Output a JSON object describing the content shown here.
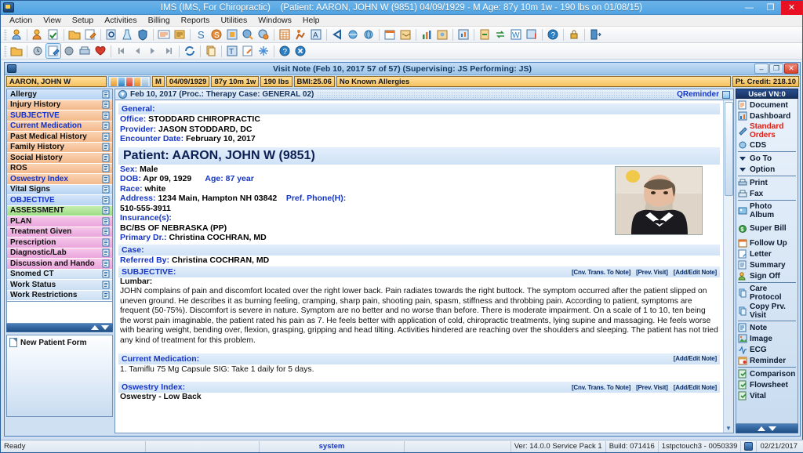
{
  "window": {
    "title": "IMS (IMS, For Chiropractic)",
    "patient_title": "(Patient: AARON, JOHN W (9851) 04/09/1929 - M Age: 87y 10m 1w - 190 lbs on 01/08/15)",
    "minimize": "—",
    "maximize": "❐",
    "close": "✕"
  },
  "menu": {
    "items": [
      "Action",
      "View",
      "Setup",
      "Activities",
      "Billing",
      "Reports",
      "Utilities",
      "Windows",
      "Help"
    ]
  },
  "visit_window": {
    "title": "Visit Note (Feb 10, 2017   57 of 57) (Supervising: JS Performing: JS)",
    "minimize": "–",
    "restore": "❐",
    "close": "✕"
  },
  "patient_bar": {
    "name": "AARON, JOHN W",
    "sex": "M",
    "dob": "04/09/1929",
    "age": "87y 10m 1w",
    "weight": "190 lbs",
    "bmi": "BMI:25.06",
    "allergies": "No Known Allergies",
    "credit": "Pt. Credit: 218.10"
  },
  "sidebar": {
    "items": [
      {
        "label": "Allergy",
        "color": "nav-blue",
        "text": ""
      },
      {
        "label": "Injury History",
        "color": "nav-orange",
        "text": ""
      },
      {
        "label": "SUBJECTIVE",
        "color": "nav-orange",
        "text": "txt-blue"
      },
      {
        "label": "Current Medication",
        "color": "nav-orange",
        "text": "txt-blue"
      },
      {
        "label": "Past Medical History",
        "color": "nav-orange",
        "text": ""
      },
      {
        "label": "Family History",
        "color": "nav-orange",
        "text": ""
      },
      {
        "label": "Social History",
        "color": "nav-orange",
        "text": ""
      },
      {
        "label": "ROS",
        "color": "nav-orange",
        "text": ""
      },
      {
        "label": "Oswestry Index",
        "color": "nav-orange",
        "text": "txt-blue"
      },
      {
        "label": "Vital Signs",
        "color": "nav-blue",
        "text": ""
      },
      {
        "label": "OBJECTIVE",
        "color": "nav-blue",
        "text": "txt-blue"
      },
      {
        "label": "ASSESSMENT",
        "color": "nav-green",
        "text": ""
      },
      {
        "label": "PLAN",
        "color": "nav-pink",
        "text": ""
      },
      {
        "label": "Treatment Given",
        "color": "nav-pink",
        "text": ""
      },
      {
        "label": "Prescription",
        "color": "nav-pink",
        "text": ""
      },
      {
        "label": "Diagnostic/Lab",
        "color": "nav-pink",
        "text": ""
      },
      {
        "label": "Discussion and Hando",
        "color": "nav-pink",
        "text": ""
      },
      {
        "label": "Snomed CT",
        "color": "nav-gray",
        "text": ""
      },
      {
        "label": "Work Status",
        "color": "nav-gray",
        "text": ""
      },
      {
        "label": "Work Restrictions",
        "color": "nav-gray",
        "text": ""
      }
    ],
    "new_patient_form": "New Patient Form"
  },
  "visit_header": {
    "date_line": "Feb 10, 2017  (Proc.: Therapy   Case: GENERAL 02)",
    "qreminder": "QReminder"
  },
  "note": {
    "general_heading": "General:",
    "office_key": "Office: ",
    "office_val": "STODDARD CHIROPRACTIC",
    "provider_key": "Provider: ",
    "provider_val": "JASON STODDARD, DC",
    "encounter_key": "Encounter Date: ",
    "encounter_val": "February 10, 2017",
    "patient_heading": "Patient: AARON, JOHN W  (9851)",
    "sex_key": "Sex: ",
    "sex_val": "Male",
    "dob_key": "DOB: ",
    "dob_val": "Apr 09, 1929",
    "age_key": "Age: ",
    "age_val": "87 year",
    "race_key": "Race: ",
    "race_val": "white",
    "address_key": "Address: ",
    "address_val": "1234 Main,  Hampton  NH  03842",
    "phone_key": "Pref. Phone(H):",
    "phone_val": "510-555-3911",
    "insurance_key": "Insurance(s):",
    "insurance_val": "BC/BS OF NEBRASKA (PP)",
    "primary_key": "Primary Dr.: ",
    "primary_val": "Christina COCHRAN, MD",
    "case_heading": "Case:",
    "referred_key": "Referred By: ",
    "referred_val": "Christina COCHRAN, MD",
    "subjective_heading": "SUBJECTIVE:",
    "subjective_sub": "Lumbar:",
    "subjective_text": "JOHN complains of pain and discomfort located over the right lower back. Pain radiates towards the right buttock. The symptom occurred after the patient slipped on uneven ground. He describes it as burning feeling, cramping, sharp pain, shooting pain, spasm, stiffness and throbbing pain. According to patient, symptoms are frequent (50-75%). Discomfort is severe  in nature. Symptom are no better and no worse  than before. There is moderate  impairment. On a scale of 1 to 10, ten being the worst pain imaginable, the patient rated his pain as 7. He feels better with application of cold, chiropractic treatments, lying supine and massaging. He feels worse with bearing weight, bending over, flexion, grasping, gripping and head tilting. Activities hindered are reaching over the shoulders and sleeping. The patient has not tried any kind of treatment for this problem.",
    "medication_heading": "Current Medication:",
    "medication_text": "1. Tamiflu 75 Mg Capsule  SIG: Take 1 daily for 5 days.",
    "oswestry_heading": "Oswestry Index:",
    "oswestry_sub": "Oswestry - Low Back",
    "act_cnv": "[Cnv. Trans. To Note]",
    "act_prev": "[Prev. Visit]",
    "act_add": "[Add/Edit Note]"
  },
  "rightnav": {
    "used_vn": "Used VN:0",
    "items": [
      {
        "label": "Document",
        "icon": "document-icon",
        "style": ""
      },
      {
        "label": "Dashboard",
        "icon": "dashboard-icon",
        "style": ""
      },
      {
        "label": "Standard Orders",
        "icon": "standard-orders-icon",
        "style": "rn-red"
      },
      {
        "label": "CDS",
        "icon": "cds-icon",
        "style": ""
      },
      {
        "sep": true
      },
      {
        "label": "Go To",
        "icon": "chevron-down-icon",
        "style": ""
      },
      {
        "label": "Option",
        "icon": "chevron-down-icon",
        "style": ""
      },
      {
        "sep": true
      },
      {
        "label": "Print",
        "icon": "print-icon",
        "style": ""
      },
      {
        "label": "Fax",
        "icon": "fax-icon",
        "style": ""
      },
      {
        "sep": true
      },
      {
        "label": "Photo Album",
        "icon": "photo-album-icon",
        "style": ""
      },
      {
        "label": "Super Bill",
        "icon": "super-bill-icon",
        "style": ""
      },
      {
        "label": "Follow Up",
        "icon": "follow-up-icon",
        "style": ""
      },
      {
        "label": "Letter",
        "icon": "letter-icon",
        "style": ""
      },
      {
        "label": "Summary",
        "icon": "summary-icon",
        "style": ""
      },
      {
        "label": "Sign Off",
        "icon": "sign-off-icon",
        "style": ""
      },
      {
        "sep": true
      },
      {
        "label": "Care Protocol",
        "icon": "care-protocol-icon",
        "style": ""
      },
      {
        "label": "Copy Prv. Visit",
        "icon": "copy-prev-visit-icon",
        "style": ""
      },
      {
        "sep": true
      },
      {
        "label": "Note",
        "icon": "note-icon",
        "style": ""
      },
      {
        "label": "Image",
        "icon": "image-icon",
        "style": ""
      },
      {
        "label": "ECG",
        "icon": "ecg-icon",
        "style": ""
      },
      {
        "label": "Reminder",
        "icon": "reminder-icon",
        "style": ""
      },
      {
        "sep": true
      },
      {
        "label": "Comparison",
        "icon": "comparison-icon",
        "style": ""
      },
      {
        "label": "Flowsheet",
        "icon": "flowsheet-icon",
        "style": ""
      },
      {
        "label": "Vital",
        "icon": "vital-icon",
        "style": ""
      }
    ]
  },
  "statusbar": {
    "ready": "Ready",
    "system": "system",
    "version": "Ver: 14.0.0 Service Pack 1",
    "build": "Build: 071416",
    "server": "1stpctouch3 - 0050339",
    "date": "02/21/2017"
  },
  "colors": {
    "title_blue": "#4fa3e3",
    "accent_orange": "#f6c362",
    "link_blue": "#1535c4",
    "alert_red": "#e01b10",
    "navy": "#15315f"
  }
}
